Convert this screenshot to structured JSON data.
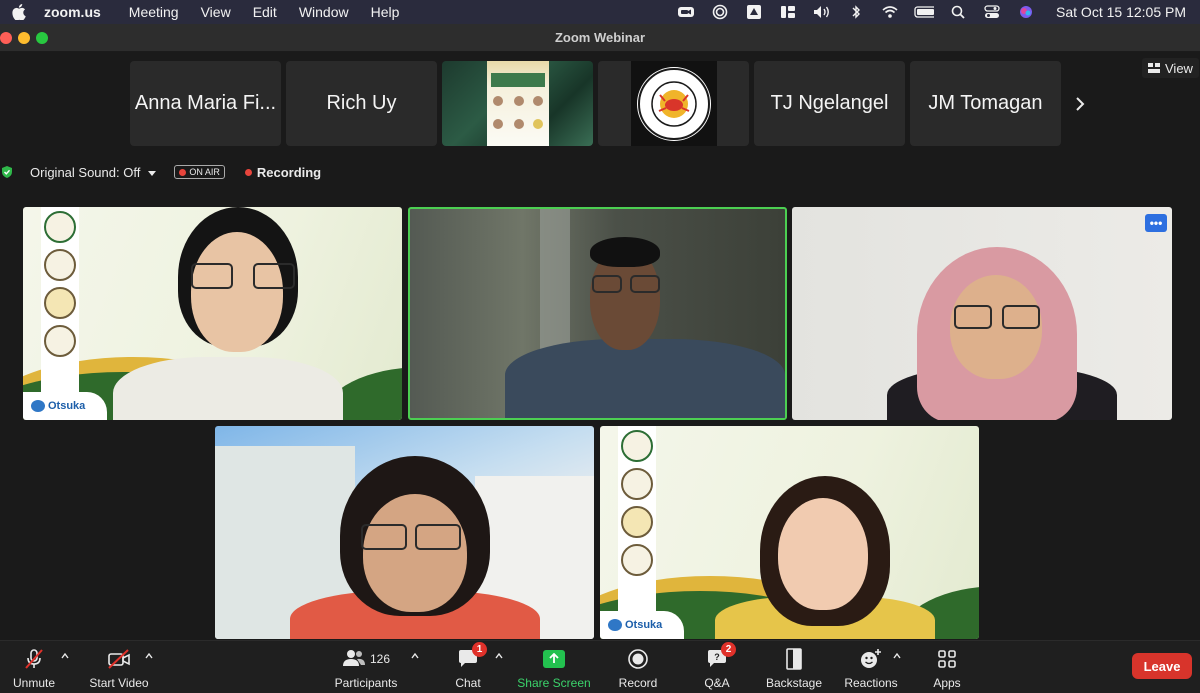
{
  "menubar": {
    "app_name": "zoom.us",
    "items": [
      "Meeting",
      "View",
      "Edit",
      "Window",
      "Help"
    ],
    "clock": "Sat Oct 15  12:05 PM",
    "status_icons": [
      "zoom-icon",
      "screen-record-icon",
      "drive-icon",
      "widget-icon",
      "volume-icon",
      "bluetooth-icon",
      "wifi-icon",
      "battery-icon",
      "spotlight-search-icon",
      "control-center-icon",
      "siri-icon"
    ]
  },
  "window": {
    "title": "Zoom Webinar"
  },
  "top_strip": {
    "tiles": [
      {
        "type": "name",
        "label": "Anna Maria Fi..."
      },
      {
        "type": "name",
        "label": "Rich Uy"
      },
      {
        "type": "poster"
      },
      {
        "type": "logo",
        "logo_text": "DEPARTMENT OF RADIOTHERAPY · JRRMMC"
      },
      {
        "type": "name",
        "label": "TJ Ngelangel"
      },
      {
        "type": "name",
        "label": "JM Tomagan"
      }
    ],
    "view_label": "View"
  },
  "status": {
    "original_sound": "Original Sound: Off",
    "on_air": "ON AIR",
    "recording": "Recording"
  },
  "videos": {
    "otsuka_label": "Otsuka",
    "more_label": "•••"
  },
  "toolbar": {
    "unmute": "Unmute",
    "start_video": "Start Video",
    "participants": "Participants",
    "participants_count": "126",
    "chat": "Chat",
    "chat_badge": "1",
    "share_screen": "Share Screen",
    "record": "Record",
    "qa": "Q&A",
    "qa_badge": "2",
    "backstage": "Backstage",
    "reactions": "Reactions",
    "apps": "Apps",
    "leave": "Leave"
  },
  "colors": {
    "accent_green": "#23c14f",
    "active_speaker_border": "#4ccf52",
    "leave_red": "#d8342b",
    "badge_red": "#e0312a",
    "menubar_bg": "#2a2b3d"
  }
}
